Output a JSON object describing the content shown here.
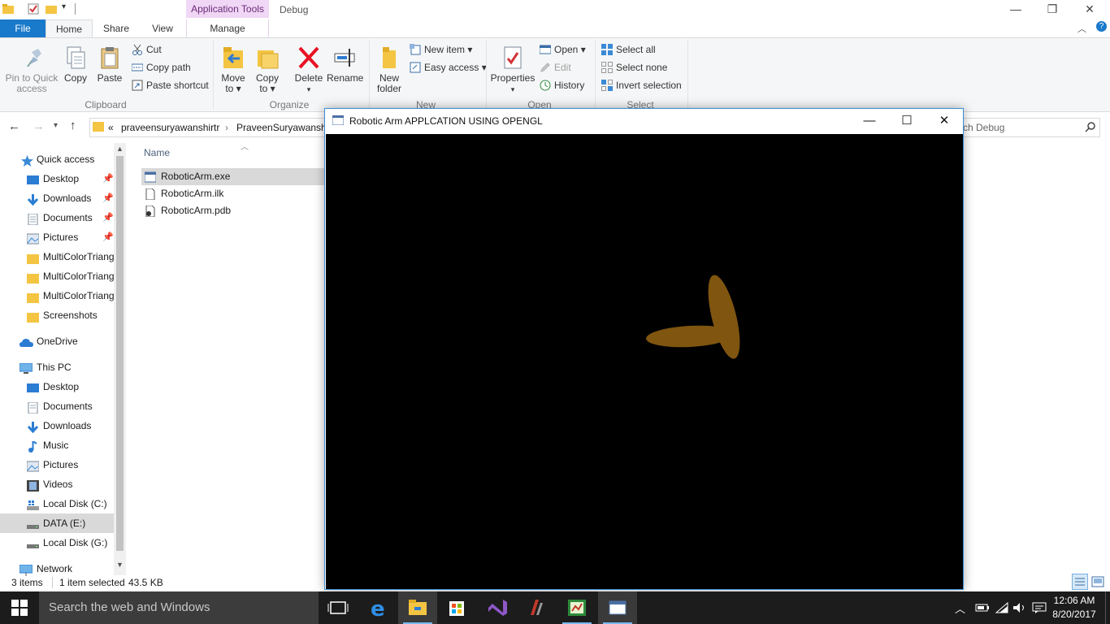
{
  "explorer": {
    "contextual_tab_header": "Application Tools",
    "window_title": "Debug",
    "tabs": [
      "File",
      "Home",
      "Share",
      "View",
      "Manage"
    ],
    "ribbon": {
      "clipboard": {
        "label": "Clipboard",
        "pin": "Pin to Quick access",
        "pin_l1": "Pin to Quick",
        "pin_l2": "access",
        "copy": "Copy",
        "paste": "Paste",
        "cut": "Cut",
        "copy_path": "Copy path",
        "paste_shortcut": "Paste shortcut"
      },
      "organize": {
        "label": "Organize",
        "move_l1": "Move",
        "move_l2": "to ▾",
        "copy_l1": "Copy",
        "copy_l2": "to ▾",
        "delete": "Delete",
        "rename": "Rename"
      },
      "new": {
        "label": "New",
        "folder_l1": "New",
        "folder_l2": "folder",
        "new_item": "New item ▾",
        "easy_access": "Easy access ▾"
      },
      "open": {
        "label": "Open",
        "properties": "Properties",
        "open": "Open ▾",
        "edit": "Edit",
        "history": "History"
      },
      "select": {
        "label": "Select",
        "select_all": "Select all",
        "select_none": "Select none",
        "invert": "Invert selection"
      }
    },
    "address": {
      "overflow": "«",
      "crumb1": "praveensuryawanshirtr",
      "crumb2": "PraveenSuryawanshi"
    },
    "search_placeholder": "ch Debug",
    "nav": {
      "quick_access": "Quick access",
      "qa_items": [
        "Desktop",
        "Downloads",
        "Documents",
        "Pictures",
        "MultiColorTriang",
        "MultiColorTriang",
        "MultiColorTriang",
        "Screenshots"
      ],
      "onedrive": "OneDrive",
      "this_pc": "This PC",
      "pc_items": [
        "Desktop",
        "Documents",
        "Downloads",
        "Music",
        "Pictures",
        "Videos",
        "Local Disk (C:)",
        "DATA (E:)",
        "Local Disk (G:)"
      ],
      "network": "Network"
    },
    "column_name": "Name",
    "files": [
      "RoboticArm.exe",
      "RoboticArm.ilk",
      "RoboticArm.pdb"
    ],
    "status": {
      "count": "3 items",
      "selected": "1 item selected",
      "size": "43.5 KB"
    }
  },
  "app_window": {
    "title": "Robotic Arm APPLCATION USING OPENGL",
    "arm_color": "#7f5510",
    "background": "#000000"
  },
  "taskbar": {
    "search_placeholder": "Search the web and Windows",
    "time": "12:06 AM",
    "date": "8/20/2017"
  }
}
